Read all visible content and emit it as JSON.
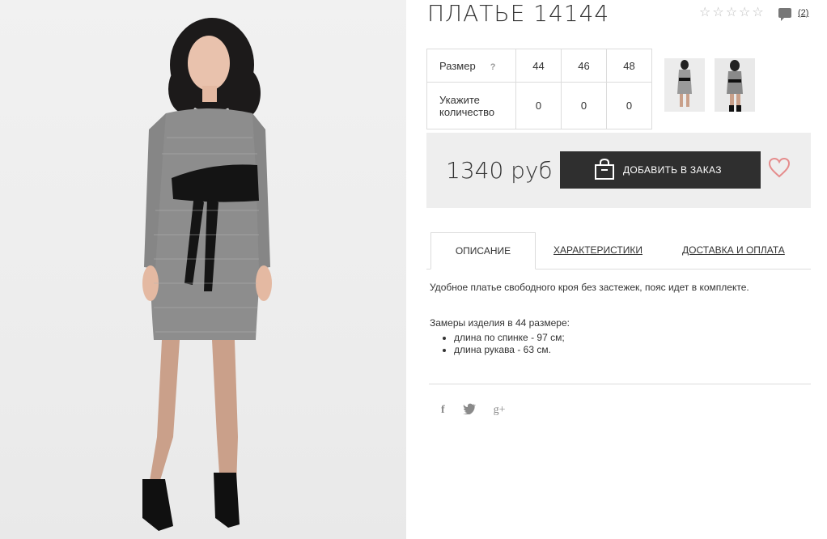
{
  "product": {
    "title": "ПЛАТЬЕ 14144",
    "comments_count": "(2)",
    "price": "1340 руб",
    "add_button": "ДОБАВИТЬ В ЗАКАЗ"
  },
  "rating": {
    "value": 0,
    "max": 5
  },
  "sizes": {
    "row_label_size": "Размер",
    "help": "?",
    "row_label_qty_line1": "Укажите",
    "row_label_qty_line2": "количество",
    "values": [
      "44",
      "46",
      "48"
    ],
    "quantities": [
      "0",
      "0",
      "0"
    ]
  },
  "tabs": {
    "description": "ОПИСАНИЕ",
    "characteristics": "ХАРАКТЕРИСТИКИ",
    "delivery": "ДОСТАВКА И ОПЛАТА"
  },
  "description": {
    "text": "Удобное платье свободного кроя без застежек, пояс идет в комплекте.",
    "measurements_title": "Замеры изделия в 44 размере:",
    "items": [
      "длина по спинке - 97 см;",
      "длина рукава - 63 см."
    ]
  },
  "social": [
    "f",
    "twitter-icon",
    "g+"
  ],
  "colors": {
    "button": "#2f2f2f",
    "heart": "#e58c8c",
    "price_bg": "#eeeeee"
  }
}
